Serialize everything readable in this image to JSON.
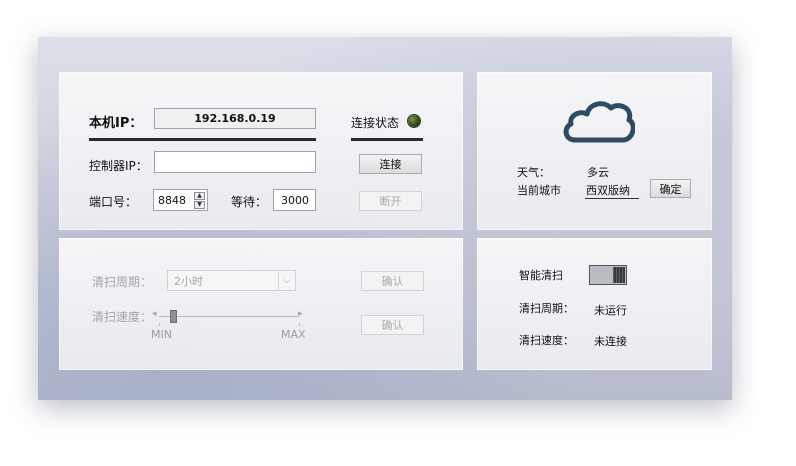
{
  "connection": {
    "local_ip_label": "本机IP：",
    "local_ip_value": "192.168.0.19",
    "status_label": "连接状态",
    "controller_ip_label": "控制器IP：",
    "controller_ip_value": "",
    "connect_button": "连接",
    "port_label": "端口号：",
    "port_value": "8848",
    "wait_label": "等待：",
    "wait_value": "3000",
    "disconnect_button": "断开"
  },
  "cleaning": {
    "period_label": "清扫周期：",
    "period_selected": "2小时",
    "confirm_period_button": "确认",
    "speed_label": "清扫速度：",
    "slider_min": "MIN",
    "slider_max": "MAX",
    "speed_level": 0.1,
    "confirm_speed_button": "确认"
  },
  "weather": {
    "weather_label": "天气：",
    "weather_value": "多云",
    "city_label": "当前城市",
    "city_value": "西双版纳",
    "confirm_button": "确定",
    "icon": "cloud-icon",
    "icon_color": "#2f4a63"
  },
  "smart_clean": {
    "title": "智能清扫",
    "toggle_on": true,
    "period_label": "清扫周期：",
    "period_status": "未运行",
    "speed_label": "清扫速度：",
    "speed_status": "未连接"
  }
}
